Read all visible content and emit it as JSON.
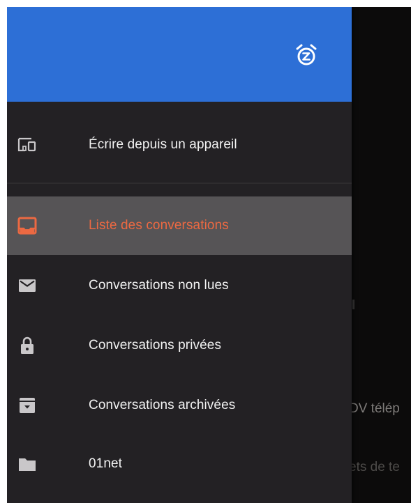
{
  "background": {
    "text_1": "DV télép",
    "text_2": "ets de te"
  },
  "header": {
    "snooze_icon": "alarm-snooze-icon",
    "color": "#2d6fd6"
  },
  "menu": {
    "top_item": {
      "label": "Écrire depuis un appareil",
      "icon": "devices-icon"
    },
    "items": [
      {
        "label": "Liste des conversations",
        "icon": "inbox-icon",
        "active": true
      },
      {
        "label": "Conversations non lues",
        "icon": "mail-icon",
        "active": false
      },
      {
        "label": "Conversations privées",
        "icon": "lock-icon",
        "active": false
      },
      {
        "label": "Conversations archivées",
        "icon": "archive-icon",
        "active": false
      },
      {
        "label": "01net",
        "icon": "folder-icon",
        "active": false
      }
    ]
  },
  "colors": {
    "drawer_bg": "#232124",
    "active_bg": "#565456",
    "active_accent": "#ec6942",
    "icon": "#c9c7c9"
  }
}
